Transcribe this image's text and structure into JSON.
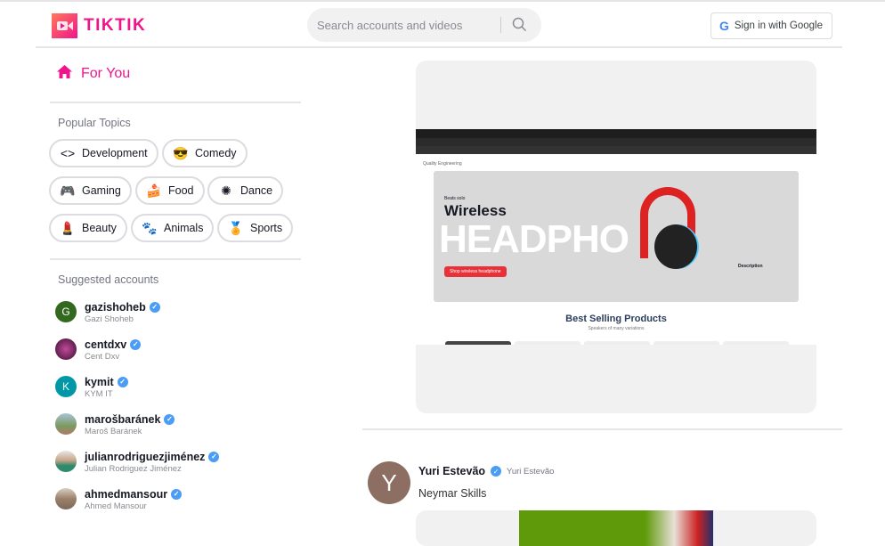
{
  "header": {
    "logo_text": "TIKTIK",
    "search_placeholder": "Search accounts and videos",
    "google_button": "Sign in with Google"
  },
  "sidebar": {
    "for_you": "For You",
    "popular_topics_title": "Popular Topics",
    "topics": [
      {
        "label": "Development",
        "icon": "code-icon"
      },
      {
        "label": "Comedy",
        "icon": "sunglasses-smiley-icon"
      },
      {
        "label": "Gaming",
        "icon": "gamepad-icon"
      },
      {
        "label": "Food",
        "icon": "cake-icon"
      },
      {
        "label": "Dance",
        "icon": "dance-icon"
      },
      {
        "label": "Beauty",
        "icon": "lipstick-icon"
      },
      {
        "label": "Animals",
        "icon": "paw-icon"
      },
      {
        "label": "Sports",
        "icon": "medal-icon"
      }
    ],
    "suggested_title": "Suggested accounts",
    "accounts": [
      {
        "username": "gazishoheb",
        "name": "Gazi Shoheb",
        "initial": "G",
        "color": "#33691e"
      },
      {
        "username": "centdxv",
        "name": "Cent Dxv",
        "initial": "",
        "color": "#5a1e4a"
      },
      {
        "username": "kymit",
        "name": "KYM IT",
        "initial": "K",
        "color": "#0097a7"
      },
      {
        "username": "marošbaránek",
        "name": "Maroš Baránek",
        "initial": "",
        "color": "#8aa07a"
      },
      {
        "username": "julianrodriguezjiménez",
        "name": "Julian Rodriguez Jiménez",
        "initial": "",
        "color": "#6b9080"
      },
      {
        "username": "ahmedmansour",
        "name": "Ahmed Mansour",
        "initial": "",
        "color": "#8d7b6a"
      }
    ]
  },
  "feed": {
    "video1": {
      "page_label": "Quality Engineering",
      "hero_small": "Beats solo",
      "hero_title": "Wireless",
      "hero_big": "HEADPHO",
      "hero_button": "Shop wireless headphone",
      "hero_desc_title": "Description",
      "section_title": "Best Selling Products",
      "section_sub": "Speakers of many variations"
    },
    "post2": {
      "author": "Yuri Estevão",
      "handle": "Yuri Estevão",
      "initial": "Y",
      "caption": "Neymar Skills",
      "avatar_color": "#8d6e63"
    }
  },
  "colors": {
    "accent": "#f0148c",
    "verified": "#4b9cf5"
  }
}
